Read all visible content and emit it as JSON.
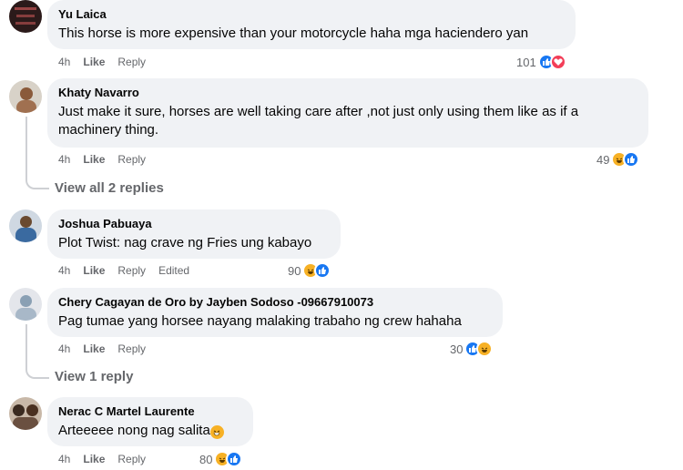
{
  "comments": [
    {
      "name": "Yu Laica",
      "text": "This horse is more expensive than your motorcycle haha mga haciendero yan",
      "time": "4h",
      "like": "Like",
      "reply": "Reply",
      "count": "101"
    },
    {
      "name": "Khaty Navarro",
      "text": "Just make it sure, horses are well taking care after ,not just only using them like as if a machinery thing.",
      "time": "4h",
      "like": "Like",
      "reply": "Reply",
      "count": "49",
      "view_replies": "View all 2 replies"
    },
    {
      "name": "Joshua Pabuaya",
      "text": "Plot Twist: nag crave ng Fries ung kabayo",
      "time": "4h",
      "like": "Like",
      "reply": "Reply",
      "edited": "Edited",
      "count": "90"
    },
    {
      "name": "Chery Cagayan de Oro by Jayben Sodoso -09667910073",
      "text": "Pag tumae yang horsee nayang malaking trabaho ng crew hahaha",
      "time": "4h",
      "like": "Like",
      "reply": "Reply",
      "count": "30",
      "view_replies": "View 1 reply"
    },
    {
      "name": "Nerac C Martel Laurente",
      "text": "Arteeeee nong nag salita",
      "time": "4h",
      "like": "Like",
      "reply": "Reply",
      "count": "80"
    }
  ],
  "colors": {
    "bubble": "#f0f2f5",
    "like": "#1877f2",
    "love": "#f33e58",
    "haha": "#f7b125",
    "meta": "#65676b"
  }
}
